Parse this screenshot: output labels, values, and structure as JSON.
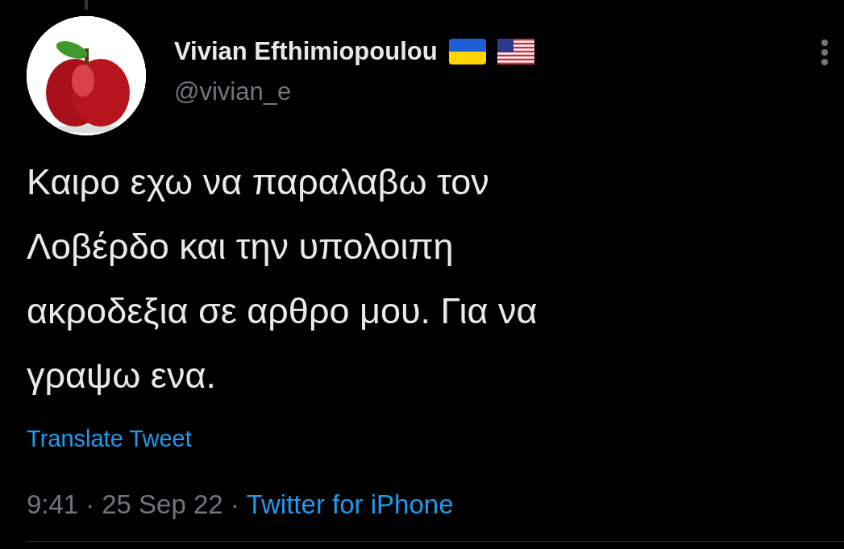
{
  "author": {
    "name": "Vivian Efthimiopoulou",
    "handle": "@vivian_e",
    "flags": [
      {
        "kind": "ukraine"
      },
      {
        "kind": "usa"
      }
    ]
  },
  "tweet": {
    "text": "Καιρο εχω να παραλαβω τον\nΛοβέρδο και την υπολοιπη\nακροδεξια σε αρθρο μου. Για να\nγραψω ενα.",
    "translate": "Translate Tweet"
  },
  "meta": [
    {
      "kind": "text",
      "text": "9:41"
    },
    {
      "kind": "sep",
      "text": "·"
    },
    {
      "kind": "text",
      "text": "25 Sep 22"
    },
    {
      "kind": "sep",
      "text": "·"
    },
    {
      "kind": "link",
      "text": "Twitter for iPhone"
    }
  ]
}
